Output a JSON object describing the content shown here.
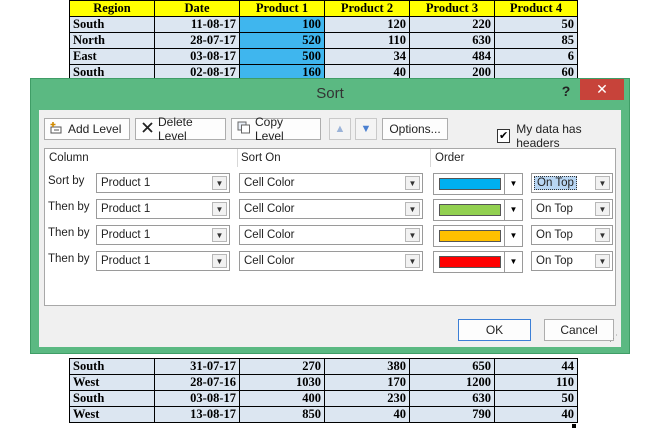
{
  "sheet": {
    "headers": [
      "Region",
      "Date",
      "Product 1",
      "Product 2",
      "Product 3",
      "Product 4"
    ],
    "top_rows": [
      [
        "South",
        "11-08-17",
        "100",
        "120",
        "220",
        "50"
      ],
      [
        "North",
        "28-07-17",
        "520",
        "110",
        "630",
        "85"
      ],
      [
        "East",
        "03-08-17",
        "500",
        "34",
        "484",
        "6"
      ],
      [
        "South",
        "02-08-17",
        "160",
        "40",
        "200",
        "60"
      ]
    ],
    "bottom_rows": [
      [
        "South",
        "31-07-17",
        "270",
        "380",
        "650",
        "44"
      ],
      [
        "West",
        "28-07-16",
        "1030",
        "170",
        "1200",
        "110"
      ],
      [
        "South",
        "03-08-17",
        "400",
        "230",
        "630",
        "50"
      ],
      [
        "West",
        "13-08-17",
        "850",
        "40",
        "790",
        "40"
      ]
    ],
    "highlight_color": "#3fb6ee"
  },
  "dialog": {
    "title": "Sort",
    "help": "?",
    "close": "✕",
    "toolbar": {
      "add_level": "Add Level",
      "delete_level": "Delete Level",
      "copy_level": "Copy Level",
      "options": "Options...",
      "my_data_has_headers": "My data has headers"
    },
    "columns": {
      "column": "Column",
      "sort_on": "Sort On",
      "order": "Order"
    },
    "rows": [
      {
        "label": "Sort by",
        "column": "Product 1",
        "sort_on": "Cell Color",
        "color": "#00b0f0",
        "position": "On Top"
      },
      {
        "label": "Then by",
        "column": "Product 1",
        "sort_on": "Cell Color",
        "color": "#92d050",
        "position": "On Top"
      },
      {
        "label": "Then by",
        "column": "Product 1",
        "sort_on": "Cell Color",
        "color": "#ffc000",
        "position": "On Top"
      },
      {
        "label": "Then by",
        "column": "Product 1",
        "sort_on": "Cell Color",
        "color": "#ff0000",
        "position": "On Top"
      }
    ],
    "ok": "OK",
    "cancel": "Cancel"
  }
}
